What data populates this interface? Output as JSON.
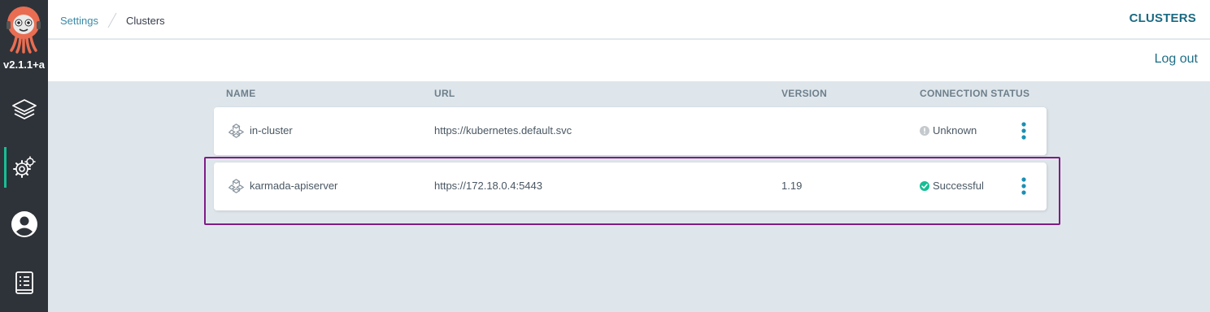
{
  "app": {
    "version": "v2.1.1+a"
  },
  "sidebar": {
    "items": [
      {
        "icon": "layers-icon",
        "label": "Applications"
      },
      {
        "icon": "gear-icon",
        "label": "Settings",
        "active": true
      },
      {
        "icon": "user-icon",
        "label": "User Info"
      },
      {
        "icon": "docs-icon",
        "label": "Documentation"
      }
    ]
  },
  "breadcrumb": {
    "parent": "Settings",
    "current": "Clusters"
  },
  "header": {
    "title": "CLUSTERS"
  },
  "toolbar": {
    "logout_label": "Log out"
  },
  "table": {
    "columns": {
      "name": "NAME",
      "url": "URL",
      "version": "VERSION",
      "status": "CONNECTION STATUS"
    },
    "rows": [
      {
        "name": "in-cluster",
        "url": "https://kubernetes.default.svc",
        "version": "",
        "status": "Unknown",
        "status_icon": "unknown-icon",
        "status_color": "#cccccc"
      },
      {
        "name": "karmada-apiserver",
        "url": "https://172.18.0.4:5443",
        "version": "1.19",
        "status": "Successful",
        "status_icon": "check-circle-icon",
        "status_color": "#18be94"
      }
    ]
  },
  "colors": {
    "accent": "#18be94",
    "link": "#1d6e87",
    "highlight": "#7e1d86",
    "sidebar_bg": "#2e3339"
  }
}
